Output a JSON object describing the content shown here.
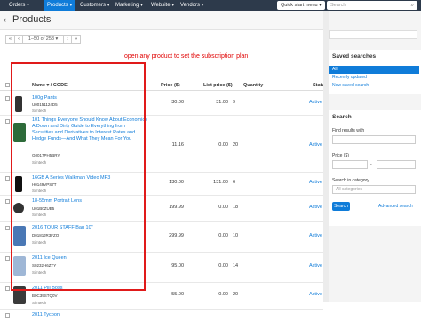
{
  "topnav": {
    "items": [
      "Orders ▾",
      "Products ▾",
      "Customers ▾",
      "Marketing ▾",
      "Website ▾",
      "Vendors ▾"
    ],
    "quick_start": "Quick start menu ▾",
    "search_placeholder": "Search"
  },
  "header": {
    "back_icon": "‹",
    "title": "Products",
    "help_icon": "?",
    "settings_icon": "⚙ ▾",
    "add_icon": "+"
  },
  "pager": {
    "first": "«",
    "prev": "‹",
    "range": "1–50 of 258 ▾",
    "next": "›",
    "last": "»"
  },
  "annotation": "open any product to set the subscription plan",
  "table": {
    "columns": {
      "name": "Name ▾ / CODE",
      "price": "Price ($)",
      "list_price": "List price ($)",
      "quantity": "Quantity",
      "status": "Status"
    },
    "rows": [
      {
        "name": "100g Pants",
        "code": "U00151124D5",
        "vendor": "Simtech",
        "price": "30.00",
        "list_price": "31.00",
        "quantity": "9",
        "status": "Active ▾"
      },
      {
        "name": "101 Things Everyone Should Know About Economics A Down and Dirty Guide to Everything from Securities and Derivatives to Interest Rates and Hedge Funds—And What They Mean For You",
        "code": "G0017PH5BRY",
        "vendor": "Simtech",
        "price": "11.16",
        "list_price": "0.00",
        "quantity": "20",
        "status": "Active ▾"
      },
      {
        "name": "16GB A Series Walkman Video MP3",
        "code": "H0149VPS7T",
        "vendor": "Simtech",
        "price": "130.00",
        "list_price": "131.00",
        "quantity": "6",
        "status": "Active ▾"
      },
      {
        "name": "18-55mm Portrait Lens",
        "code": "U01B0ZUB5",
        "vendor": "Simtech",
        "price": "199.99",
        "list_price": "0.00",
        "quantity": "18",
        "status": "Active ▾"
      },
      {
        "name": "2016 TOUR STAFF Bag 10\"",
        "code": "D0181JR3FZO",
        "vendor": "Simtech",
        "price": "299.99",
        "list_price": "0.00",
        "quantity": "10",
        "status": "Active ▾"
      },
      {
        "name": "2011 Ice Queen",
        "code": "S0232H6ZTY",
        "vendor": "Simtech",
        "price": "95.00",
        "list_price": "0.00",
        "quantity": "14",
        "status": "Active ▾"
      },
      {
        "name": "2011 Pill Boss",
        "code": "B0C39STQ0V",
        "vendor": "Simtech",
        "price": "55.00",
        "list_price": "0.00",
        "quantity": "20",
        "status": "Active ▾"
      },
      {
        "name": "2011 Tycoon",
        "code": "",
        "vendor": "",
        "price": "",
        "list_price": "",
        "quantity": "",
        "status": ""
      }
    ]
  },
  "sidebar": {
    "saved_title": "Saved searches",
    "saved_items": [
      "All",
      "Recently updated",
      "New saved search"
    ],
    "search_title": "Search",
    "find_label": "Find results with",
    "price_label": "Price ($)",
    "price_dash": "-",
    "category_label": "Search in category",
    "category_placeholder": "All categories",
    "search_button": "Search",
    "advanced_link": "Advanced search"
  }
}
